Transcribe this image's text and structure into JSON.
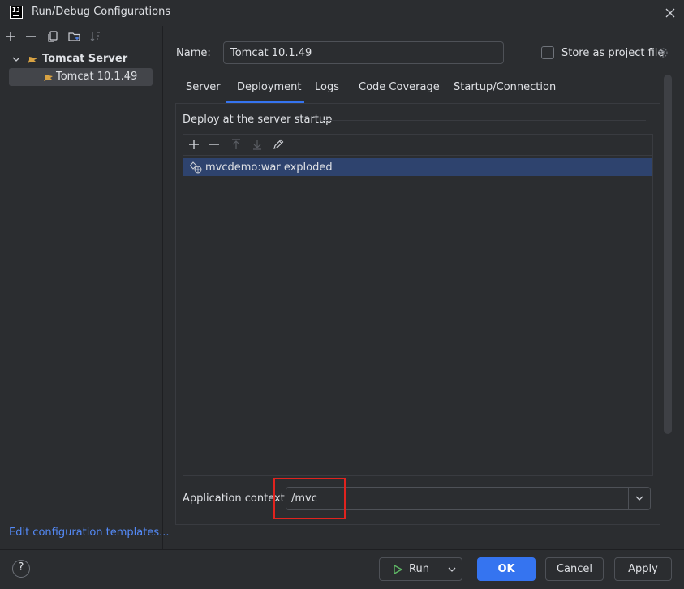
{
  "window": {
    "title": "Run/Debug Configurations"
  },
  "sidebar": {
    "group_label": "Tomcat Server",
    "item_label": "Tomcat 10.1.49",
    "edit_templates_link": "Edit configuration templates..."
  },
  "form": {
    "name_label": "Name:",
    "name_value": "Tomcat 10.1.49",
    "store_label": "Store as project file"
  },
  "tabs": [
    {
      "label": "Server"
    },
    {
      "label": "Deployment"
    },
    {
      "label": "Logs"
    },
    {
      "label": "Code Coverage"
    },
    {
      "label": "Startup/Connection"
    }
  ],
  "deployment": {
    "section_title": "Deploy at the server startup",
    "artifacts": [
      {
        "label": "mvcdemo:war exploded"
      }
    ],
    "context_label": "Application context:",
    "context_value": "/mvc"
  },
  "footer": {
    "help": "?",
    "run_label": "Run",
    "ok_label": "OK",
    "cancel_label": "Cancel",
    "apply_label": "Apply"
  },
  "colors": {
    "background": "#2b2d30",
    "accent": "#3574f0",
    "selection": "#2e436e",
    "link": "#548af7",
    "highlight": "#e0231e"
  }
}
